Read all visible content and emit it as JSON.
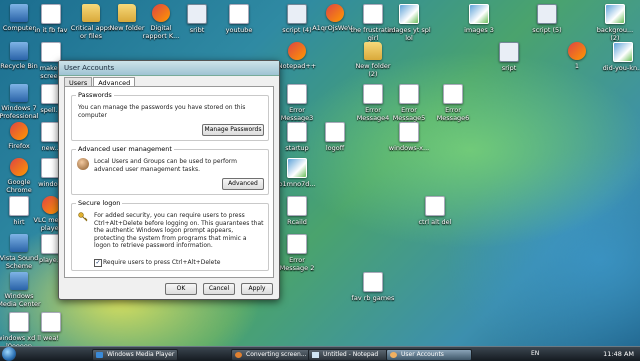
{
  "desktop": {
    "icons": [
      {
        "label": "Computer",
        "kind": "blue"
      },
      {
        "label": "in it fb fav",
        "kind": "doc"
      },
      {
        "label": "Critical apps or files",
        "kind": "folder"
      },
      {
        "label": "New folder",
        "kind": "folder"
      },
      {
        "label": "Digital rapport K...",
        "kind": "app"
      },
      {
        "label": "sribt",
        "kind": "script"
      },
      {
        "label": "youtube",
        "kind": "doc"
      },
      {
        "label": "script (4)",
        "kind": "script"
      },
      {
        "label": "A1qrOjsWeV...",
        "kind": "app"
      },
      {
        "label": "the frustrated girl",
        "kind": "doc"
      },
      {
        "label": "images yt spl lol",
        "kind": "img"
      },
      {
        "label": "images 3",
        "kind": "img"
      },
      {
        "label": "script (5)",
        "kind": "script"
      },
      {
        "label": "backgrou... (2)",
        "kind": "img"
      },
      {
        "label": "Recycle Bin",
        "kind": "blue"
      },
      {
        "label": "make t screen",
        "kind": "doc"
      },
      {
        "label": "Notepad++",
        "kind": "app"
      },
      {
        "label": "New folder (2)",
        "kind": "folder"
      },
      {
        "label": "sript",
        "kind": "script"
      },
      {
        "label": "1",
        "kind": "app"
      },
      {
        "label": "did-you-kn...",
        "kind": "img"
      },
      {
        "label": "Windows 7 Professional",
        "kind": "blue"
      },
      {
        "label": "spell...",
        "kind": "doc"
      },
      {
        "label": "Error Message3",
        "kind": "doc"
      },
      {
        "label": "Error Message4",
        "kind": "doc"
      },
      {
        "label": "Error Message5",
        "kind": "doc"
      },
      {
        "label": "Error Message6",
        "kind": "doc"
      },
      {
        "label": "Firefox",
        "kind": "app"
      },
      {
        "label": "new...",
        "kind": "doc"
      },
      {
        "label": "startup",
        "kind": "doc"
      },
      {
        "label": "logoff",
        "kind": "doc"
      },
      {
        "label": "windows-x...",
        "kind": "doc"
      },
      {
        "label": "Google Chrome",
        "kind": "app"
      },
      {
        "label": "windo...",
        "kind": "doc"
      },
      {
        "label": "b1mno7d...",
        "kind": "img"
      },
      {
        "label": "hirt",
        "kind": "doc"
      },
      {
        "label": "VLC media player",
        "kind": "app"
      },
      {
        "label": "Rcaild",
        "kind": "doc"
      },
      {
        "label": "ctrl alt del",
        "kind": "doc"
      },
      {
        "label": "Vista Sound Scheme",
        "kind": "blue"
      },
      {
        "label": "playe...",
        "kind": "doc"
      },
      {
        "label": "Error Message 2",
        "kind": "doc"
      },
      {
        "label": "Windows Media Center",
        "kind": "blue"
      },
      {
        "label": "fav rb games",
        "kind": "doc"
      },
      {
        "label": "windows xd ll l0oooon",
        "kind": "doc"
      },
      {
        "label": "wea!",
        "kind": "doc"
      }
    ]
  },
  "dialog": {
    "title": "User Accounts",
    "tabs": [
      "Users",
      "Advanced"
    ],
    "passwords": {
      "heading": "Passwords",
      "text": "You can manage the passwords you have stored on this computer",
      "button": "Manage Passwords"
    },
    "advanced": {
      "heading": "Advanced user management",
      "text": "Local Users and Groups can be used to perform advanced user management tasks.",
      "button": "Advanced"
    },
    "secure": {
      "heading": "Secure logon",
      "text": "For added security, you can require users to press Ctrl+Alt+Delete before logging on. This guarantees that the authentic Windows logon prompt appears, protecting the system from programs that mimic a logon to retrieve password information.",
      "checkbox_label": "Require users to press Ctrl+Alt+Delete",
      "checked": true
    },
    "ok": "OK",
    "cancel": "Cancel",
    "apply": "Apply"
  },
  "taskbar": {
    "buttons": [
      {
        "label": "Windows Media Player",
        "active": false
      },
      {
        "label": "Converting screen...",
        "active": false
      },
      {
        "label": "Untitled - Notepad",
        "active": false
      },
      {
        "label": "User Accounts",
        "active": true
      }
    ],
    "lang": "EN",
    "clock": "11:48 AM"
  }
}
